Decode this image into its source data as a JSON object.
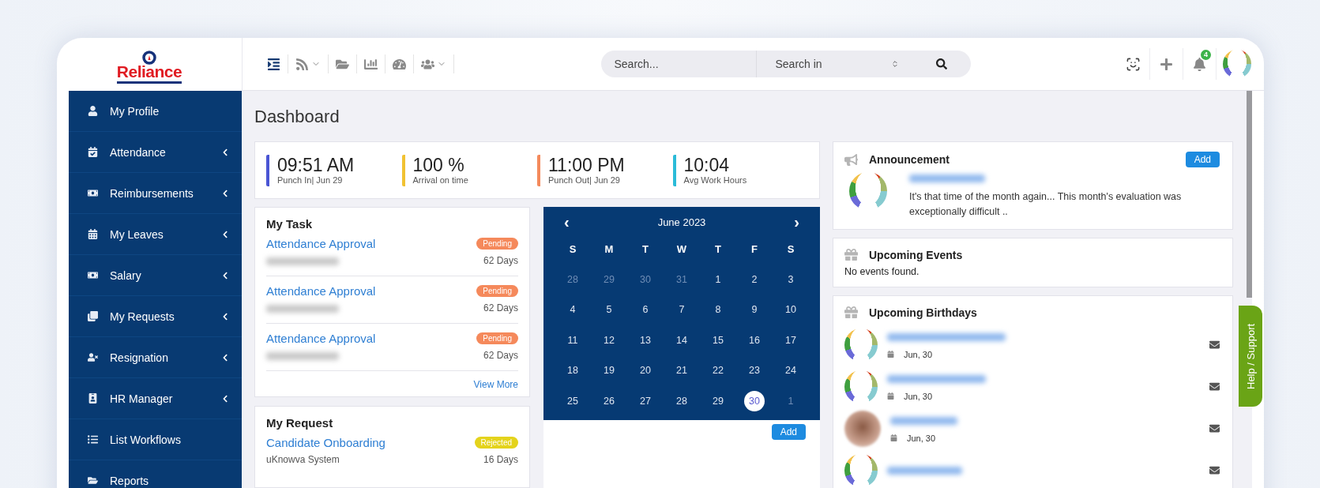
{
  "logo": "Reliance",
  "search": {
    "placeholder": "Search...",
    "scope": "Search in"
  },
  "notifications": {
    "count": "4"
  },
  "sidebar": {
    "items": [
      {
        "label": "My Profile",
        "expandable": false
      },
      {
        "label": "Attendance",
        "expandable": true
      },
      {
        "label": "Reimbursements",
        "expandable": true
      },
      {
        "label": "My Leaves",
        "expandable": true
      },
      {
        "label": "Salary",
        "expandable": true
      },
      {
        "label": "My Requests",
        "expandable": true
      },
      {
        "label": "Resignation",
        "expandable": true
      },
      {
        "label": "HR Manager",
        "expandable": true
      },
      {
        "label": "List Workflows",
        "expandable": false
      },
      {
        "label": "Reports",
        "expandable": false
      }
    ]
  },
  "page_title": "Dashboard",
  "stats": [
    {
      "value": "09:51 AM",
      "label": "Punch In| Jun 29",
      "color": "#4a55d4"
    },
    {
      "value": "100 %",
      "label": "Arrival on time",
      "color": "#f1c232"
    },
    {
      "value": "11:00 PM",
      "label": "Punch Out| Jun 29",
      "color": "#f48a5c"
    },
    {
      "value": "10:04",
      "label": "Avg Work Hours",
      "color": "#2bbbd8"
    }
  ],
  "my_task": {
    "title": "My Task",
    "view_more": "View More",
    "items": [
      {
        "title": "Attendance Approval",
        "status": "Pending",
        "color": "#f5895b",
        "days": "62 Days"
      },
      {
        "title": "Attendance Approval",
        "status": "Pending",
        "color": "#f5895b",
        "days": "62 Days"
      },
      {
        "title": "Attendance Approval",
        "status": "Pending",
        "color": "#f5895b",
        "days": "62 Days"
      }
    ]
  },
  "calendar": {
    "month": "June 2023",
    "prev": "‹",
    "next": "›",
    "add": "Add",
    "weekdays": [
      "S",
      "M",
      "T",
      "W",
      "T",
      "F",
      "S"
    ],
    "weeks": [
      [
        {
          "day": "28",
          "outside": true,
          "selected": false
        },
        {
          "day": "29",
          "outside": true,
          "selected": false
        },
        {
          "day": "30",
          "outside": true,
          "selected": false
        },
        {
          "day": "31",
          "outside": true,
          "selected": false
        },
        {
          "day": "1",
          "outside": false,
          "selected": false
        },
        {
          "day": "2",
          "outside": false,
          "selected": false
        },
        {
          "day": "3",
          "outside": false,
          "selected": false
        }
      ],
      [
        {
          "day": "4",
          "outside": false,
          "selected": false
        },
        {
          "day": "5",
          "outside": false,
          "selected": false
        },
        {
          "day": "6",
          "outside": false,
          "selected": false
        },
        {
          "day": "7",
          "outside": false,
          "selected": false
        },
        {
          "day": "8",
          "outside": false,
          "selected": false
        },
        {
          "day": "9",
          "outside": false,
          "selected": false
        },
        {
          "day": "10",
          "outside": false,
          "selected": false
        }
      ],
      [
        {
          "day": "11",
          "outside": false,
          "selected": false
        },
        {
          "day": "12",
          "outside": false,
          "selected": false
        },
        {
          "day": "13",
          "outside": false,
          "selected": false
        },
        {
          "day": "14",
          "outside": false,
          "selected": false
        },
        {
          "day": "15",
          "outside": false,
          "selected": false
        },
        {
          "day": "16",
          "outside": false,
          "selected": false
        },
        {
          "day": "17",
          "outside": false,
          "selected": false
        }
      ],
      [
        {
          "day": "18",
          "outside": false,
          "selected": false
        },
        {
          "day": "19",
          "outside": false,
          "selected": false
        },
        {
          "day": "20",
          "outside": false,
          "selected": false
        },
        {
          "day": "21",
          "outside": false,
          "selected": false
        },
        {
          "day": "22",
          "outside": false,
          "selected": false
        },
        {
          "day": "23",
          "outside": false,
          "selected": false
        },
        {
          "day": "24",
          "outside": false,
          "selected": false
        }
      ],
      [
        {
          "day": "25",
          "outside": false,
          "selected": false
        },
        {
          "day": "26",
          "outside": false,
          "selected": false
        },
        {
          "day": "27",
          "outside": false,
          "selected": false
        },
        {
          "day": "28",
          "outside": false,
          "selected": false
        },
        {
          "day": "29",
          "outside": false,
          "selected": false
        },
        {
          "day": "30",
          "outside": false,
          "selected": true
        },
        {
          "day": "1",
          "outside": true,
          "selected": false
        }
      ]
    ]
  },
  "my_request": {
    "title": "My Request",
    "items": [
      {
        "title": "Candidate Onboarding",
        "status": "Rejected",
        "color": "#e4d31c",
        "requester": "uKnowva System",
        "days": "16 Days"
      }
    ]
  },
  "announcement": {
    "title": "Announcement",
    "add": "Add",
    "text": "It's that time of the month again... This month's evaluation was exceptionally difficult .."
  },
  "events": {
    "title": "Upcoming Events",
    "empty": "No events found."
  },
  "birthdays": {
    "title": "Upcoming Birthdays",
    "items": [
      {
        "kind": "avatar",
        "date": "Jun, 30"
      },
      {
        "kind": "avatar",
        "date": "Jun, 30"
      },
      {
        "kind": "photo",
        "date": "Jun, 30"
      },
      {
        "kind": "avatar"
      }
    ]
  },
  "help_tab": "Help / Support"
}
